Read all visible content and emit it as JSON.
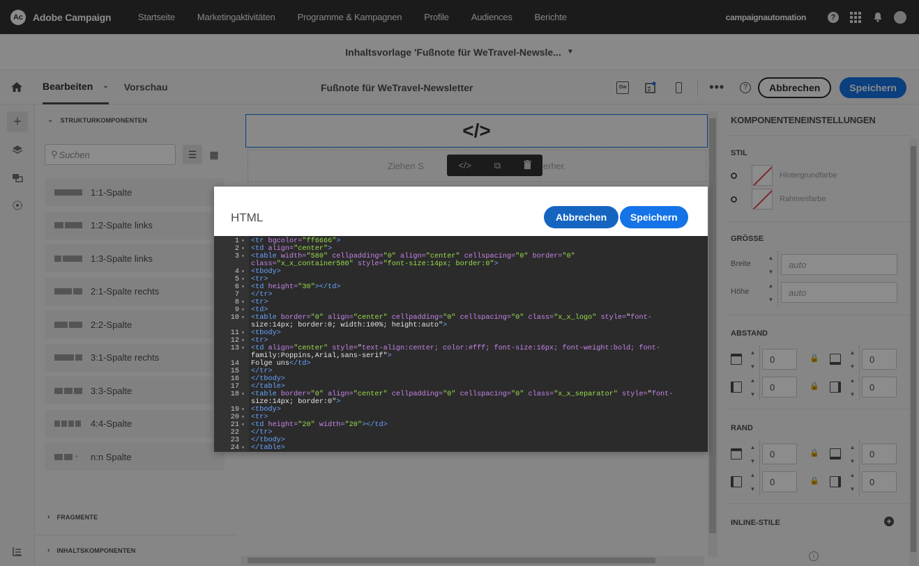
{
  "app": {
    "name": "Adobe Campaign",
    "logo_letters": "Ac"
  },
  "nav": [
    "Startseite",
    "Marketingaktivitäten",
    "Programme & Kampagnen",
    "Profile",
    "Audiences",
    "Berichte"
  ],
  "user": {
    "name": "campaignautomation"
  },
  "icons": {
    "help": "help-icon",
    "apps": "apps-grid-icon",
    "notifications": "bell-icon",
    "avatar": "avatar-icon"
  },
  "subbar": {
    "title": "Inhaltsvorlage 'Fußnote für WeTravel-Newsle..."
  },
  "toolbar": {
    "tab_edit": "Bearbeiten",
    "tab_preview": "Vorschau",
    "doc_title": "Fußnote für WeTravel-Newsletter",
    "dw_label": "Dw",
    "help_label": "?",
    "cancel": "Abbrechen",
    "save": "Speichern"
  },
  "left_panel": {
    "structure_header": "STRUKTURKOMPONENTEN",
    "search_placeholder": "Suchen",
    "components": [
      {
        "label": "1:1-Spalte",
        "cols": [
          40
        ]
      },
      {
        "label": "1:2-Spalte links",
        "cols": [
          13,
          25
        ]
      },
      {
        "label": "1:3-Spalte links",
        "cols": [
          10,
          28
        ]
      },
      {
        "label": "2:1-Spalte rechts",
        "cols": [
          25,
          13
        ]
      },
      {
        "label": "2:2-Spalte",
        "cols": [
          19,
          19
        ]
      },
      {
        "label": "3:1-Spalte rechts",
        "cols": [
          28,
          10
        ]
      },
      {
        "label": "3:3-Spalte",
        "cols": [
          12,
          12,
          12
        ]
      },
      {
        "label": "4:4-Spalte",
        "cols": [
          8,
          8,
          8,
          8
        ]
      },
      {
        "label": "n:n Spalte",
        "cols": [
          12,
          12
        ]
      }
    ],
    "fragments_header": "FRAGMENTE",
    "content_header": "INHALTSKOMPONENTEN"
  },
  "canvas": {
    "drop_text_left": "Ziehen S",
    "drop_text_right": "e hierher."
  },
  "right_panel": {
    "title": "KOMPONENTENEINSTELLUNGEN",
    "style_header": "STIL",
    "bg_color": "Hintergrundfarbe",
    "border_color": "Rahmenfarbe",
    "size_header": "GRÖSSE",
    "width_label": "Breite",
    "height_label": "Höhe",
    "width_value": "auto",
    "height_value": "auto",
    "spacing_header": "ABSTAND",
    "spacing_values": [
      "0",
      "0",
      "0",
      "0"
    ],
    "border_header": "RAND",
    "border_values": [
      "0",
      "0",
      "0",
      "0"
    ],
    "inline_header": "INLINE-STILE"
  },
  "modal": {
    "title": "HTML",
    "cancel": "Abbrechen",
    "save": "Speichern",
    "lines": [
      {
        "n": "1",
        "f": true,
        "code": "<tr bgcolor=\"ff6666\">"
      },
      {
        "n": "2",
        "f": true,
        "code": "<td align=\"center\">"
      },
      {
        "n": "3",
        "f": true,
        "code": "<table width=\"580\" cellpadding=\"0\" align=\"center\" cellspacing=\"0\" border=\"0\""
      },
      {
        "n": "",
        "f": false,
        "code": "class=\"x_x_container580\" style=\"font-size:14px; border:0\">"
      },
      {
        "n": "4",
        "f": true,
        "code": "<tbody>"
      },
      {
        "n": "5",
        "f": true,
        "code": "<tr>"
      },
      {
        "n": "6",
        "f": true,
        "code": "<td height=\"30\"></td>"
      },
      {
        "n": "7",
        "f": false,
        "code": "</tr>"
      },
      {
        "n": "8",
        "f": true,
        "code": "<tr>"
      },
      {
        "n": "9",
        "f": true,
        "code": "<td>"
      },
      {
        "n": "10",
        "f": true,
        "code": "<table border=\"0\" align=\"center\" cellpadding=\"0\" cellspacing=\"0\" class=\"x_x_logo\" style=\"font-"
      },
      {
        "n": "",
        "f": false,
        "code": "size:14px; border:0; width:100%; height:auto\">"
      },
      {
        "n": "11",
        "f": true,
        "code": "<tbody>"
      },
      {
        "n": "12",
        "f": true,
        "code": "<tr>"
      },
      {
        "n": "13",
        "f": true,
        "code": "<td align=\"center\" style=\"text-align:center; color:#fff; font-size:16px; font-weight:bold; font-"
      },
      {
        "n": "",
        "f": false,
        "code": "family:Poppins,Arial,sans-serif\">"
      },
      {
        "n": "14",
        "f": false,
        "code": "Folge uns</td>"
      },
      {
        "n": "15",
        "f": false,
        "code": "</tr>"
      },
      {
        "n": "16",
        "f": false,
        "code": "</tbody>"
      },
      {
        "n": "17",
        "f": false,
        "code": "</table>"
      },
      {
        "n": "18",
        "f": true,
        "code": "<table border=\"0\" align=\"center\" cellpadding=\"0\" cellspacing=\"0\" class=\"x_x_separator\" style=\"font-"
      },
      {
        "n": "",
        "f": false,
        "code": "size:14px; border:0\">"
      },
      {
        "n": "19",
        "f": true,
        "code": "<tbody>"
      },
      {
        "n": "20",
        "f": true,
        "code": "<tr>"
      },
      {
        "n": "21",
        "f": true,
        "code": "<td height=\"20\" width=\"20\"></td>"
      },
      {
        "n": "22",
        "f": false,
        "code": "</tr>"
      },
      {
        "n": "23",
        "f": false,
        "code": "</tbody>"
      },
      {
        "n": "24",
        "f": true,
        "code": "</table>"
      }
    ]
  },
  "colors": {
    "primary": "#1473e6",
    "topbar": "#323232",
    "editor_bg": "#2b2b2b",
    "tag": "#6aa4ff",
    "attr": "#c585e8",
    "string": "#9bdd4c"
  }
}
